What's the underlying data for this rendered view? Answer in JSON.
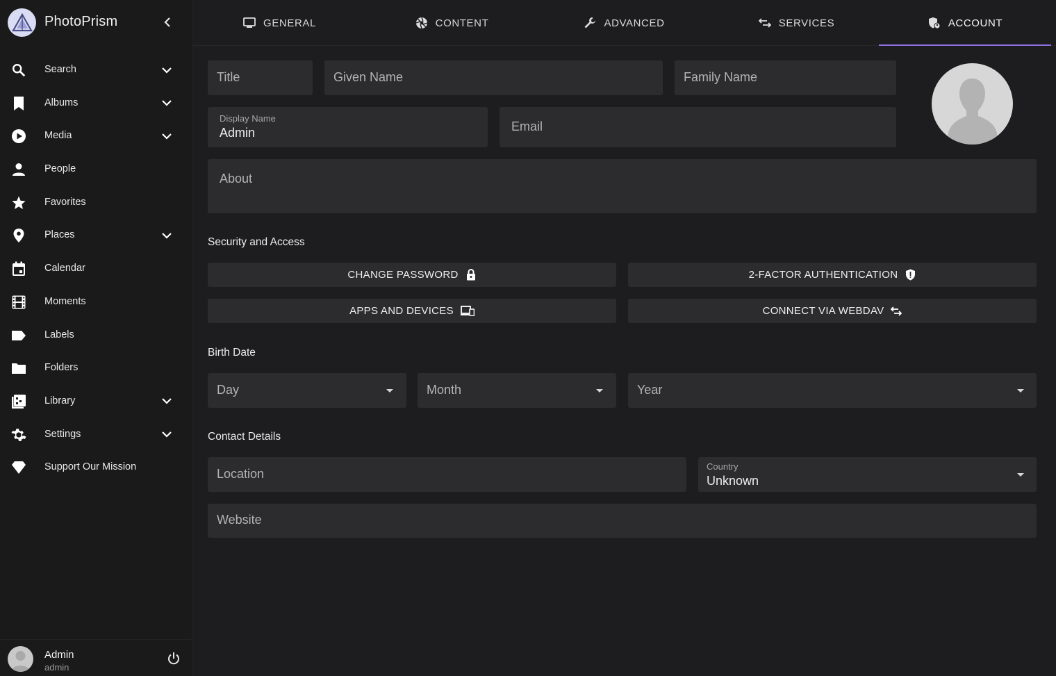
{
  "app": {
    "name": "PhotoPrism"
  },
  "sidebar": {
    "items": [
      {
        "label": "Search",
        "icon": "magnify-icon",
        "expandable": true
      },
      {
        "label": "Albums",
        "icon": "bookmark-icon",
        "expandable": true
      },
      {
        "label": "Media",
        "icon": "play-circle-icon",
        "expandable": true
      },
      {
        "label": "People",
        "icon": "person-icon",
        "expandable": false
      },
      {
        "label": "Favorites",
        "icon": "star-icon",
        "expandable": false
      },
      {
        "label": "Places",
        "icon": "map-pin-icon",
        "expandable": true
      },
      {
        "label": "Calendar",
        "icon": "calendar-icon",
        "expandable": false
      },
      {
        "label": "Moments",
        "icon": "film-icon",
        "expandable": false
      },
      {
        "label": "Labels",
        "icon": "label-icon",
        "expandable": false
      },
      {
        "label": "Folders",
        "icon": "folder-icon",
        "expandable": false
      },
      {
        "label": "Library",
        "icon": "library-icon",
        "expandable": true
      },
      {
        "label": "Settings",
        "icon": "gear-icon",
        "expandable": true
      },
      {
        "label": "Support Our Mission",
        "icon": "diamond-icon",
        "expandable": false
      }
    ]
  },
  "user": {
    "name": "Admin",
    "login": "admin"
  },
  "tabs": [
    {
      "label": "GENERAL",
      "icon": "monitor-icon",
      "active": false
    },
    {
      "label": "CONTENT",
      "icon": "aperture-icon",
      "active": false
    },
    {
      "label": "ADVANCED",
      "icon": "wrench-icon",
      "active": false
    },
    {
      "label": "SERVICES",
      "icon": "swap-icon",
      "active": false
    },
    {
      "label": "ACCOUNT",
      "icon": "account-shield-icon",
      "active": true
    }
  ],
  "form": {
    "title_placeholder": "Title",
    "given_name_placeholder": "Given Name",
    "family_name_placeholder": "Family Name",
    "display_name_label": "Display Name",
    "display_name_value": "Admin",
    "email_placeholder": "Email",
    "about_placeholder": "About",
    "security_title": "Security and Access",
    "change_password_label": "CHANGE PASSWORD",
    "two_factor_label": "2-FACTOR AUTHENTICATION",
    "apps_devices_label": "APPS AND DEVICES",
    "webdav_label": "CONNECT VIA WEBDAV",
    "birth_date_title": "Birth Date",
    "day_placeholder": "Day",
    "month_placeholder": "Month",
    "year_placeholder": "Year",
    "contact_title": "Contact Details",
    "location_placeholder": "Location",
    "country_label": "Country",
    "country_value": "Unknown",
    "website_placeholder": "Website"
  },
  "colors": {
    "accent": "#8b6fe0",
    "field_bg": "#2c2c2e",
    "page_bg": "#1d1d1f",
    "sidebar_bg": "#1a1a1b"
  }
}
